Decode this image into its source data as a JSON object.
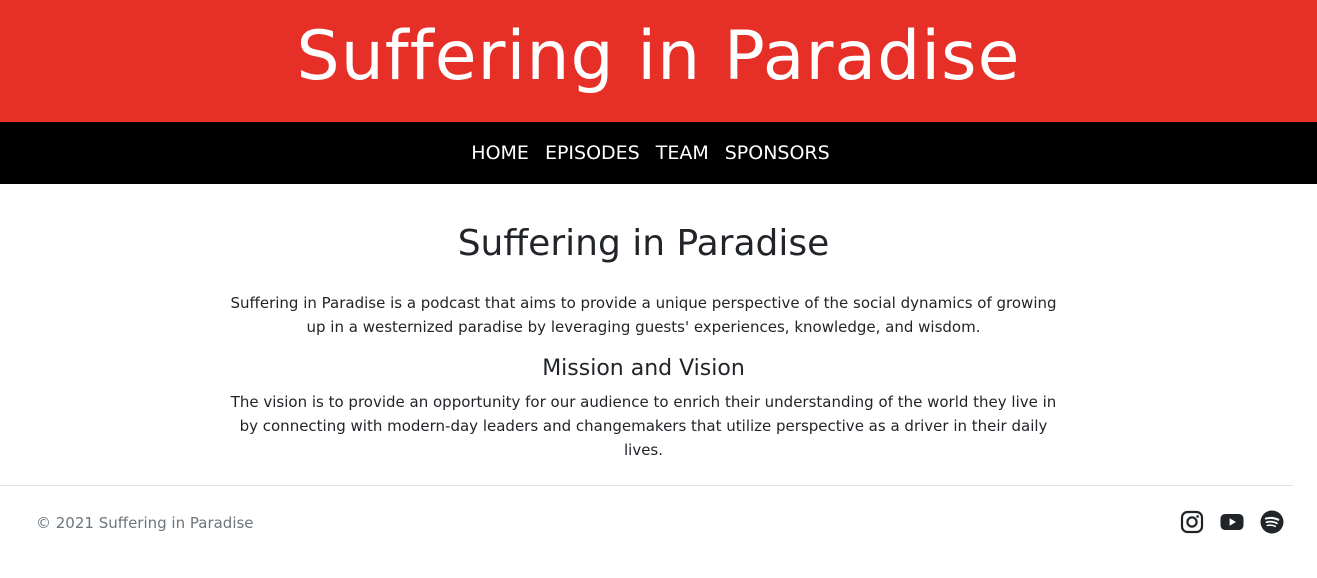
{
  "banner": {
    "title": "Suffering in Paradise",
    "background": "#e63027"
  },
  "nav": {
    "items": [
      {
        "label": "HOME"
      },
      {
        "label": "EPISODES"
      },
      {
        "label": "TEAM"
      },
      {
        "label": "SPONSORS"
      }
    ]
  },
  "main": {
    "heading": "Suffering in Paradise",
    "intro": "Suffering in Paradise is a podcast that aims to provide a unique perspective of the social dynamics of growing up in a westernized paradise by leveraging guests' experiences, knowledge, and wisdom.",
    "mission_heading": "Mission and Vision",
    "vision": "The vision is to provide an opportunity for our audience to enrich their understanding of the world they live in by connecting with modern-day leaders and changemakers that utilize perspective as a driver in their daily lives."
  },
  "footer": {
    "copyright": "© 2021 Suffering in Paradise",
    "social": [
      {
        "icon": "instagram-icon"
      },
      {
        "icon": "youtube-icon"
      },
      {
        "icon": "spotify-icon"
      }
    ]
  }
}
